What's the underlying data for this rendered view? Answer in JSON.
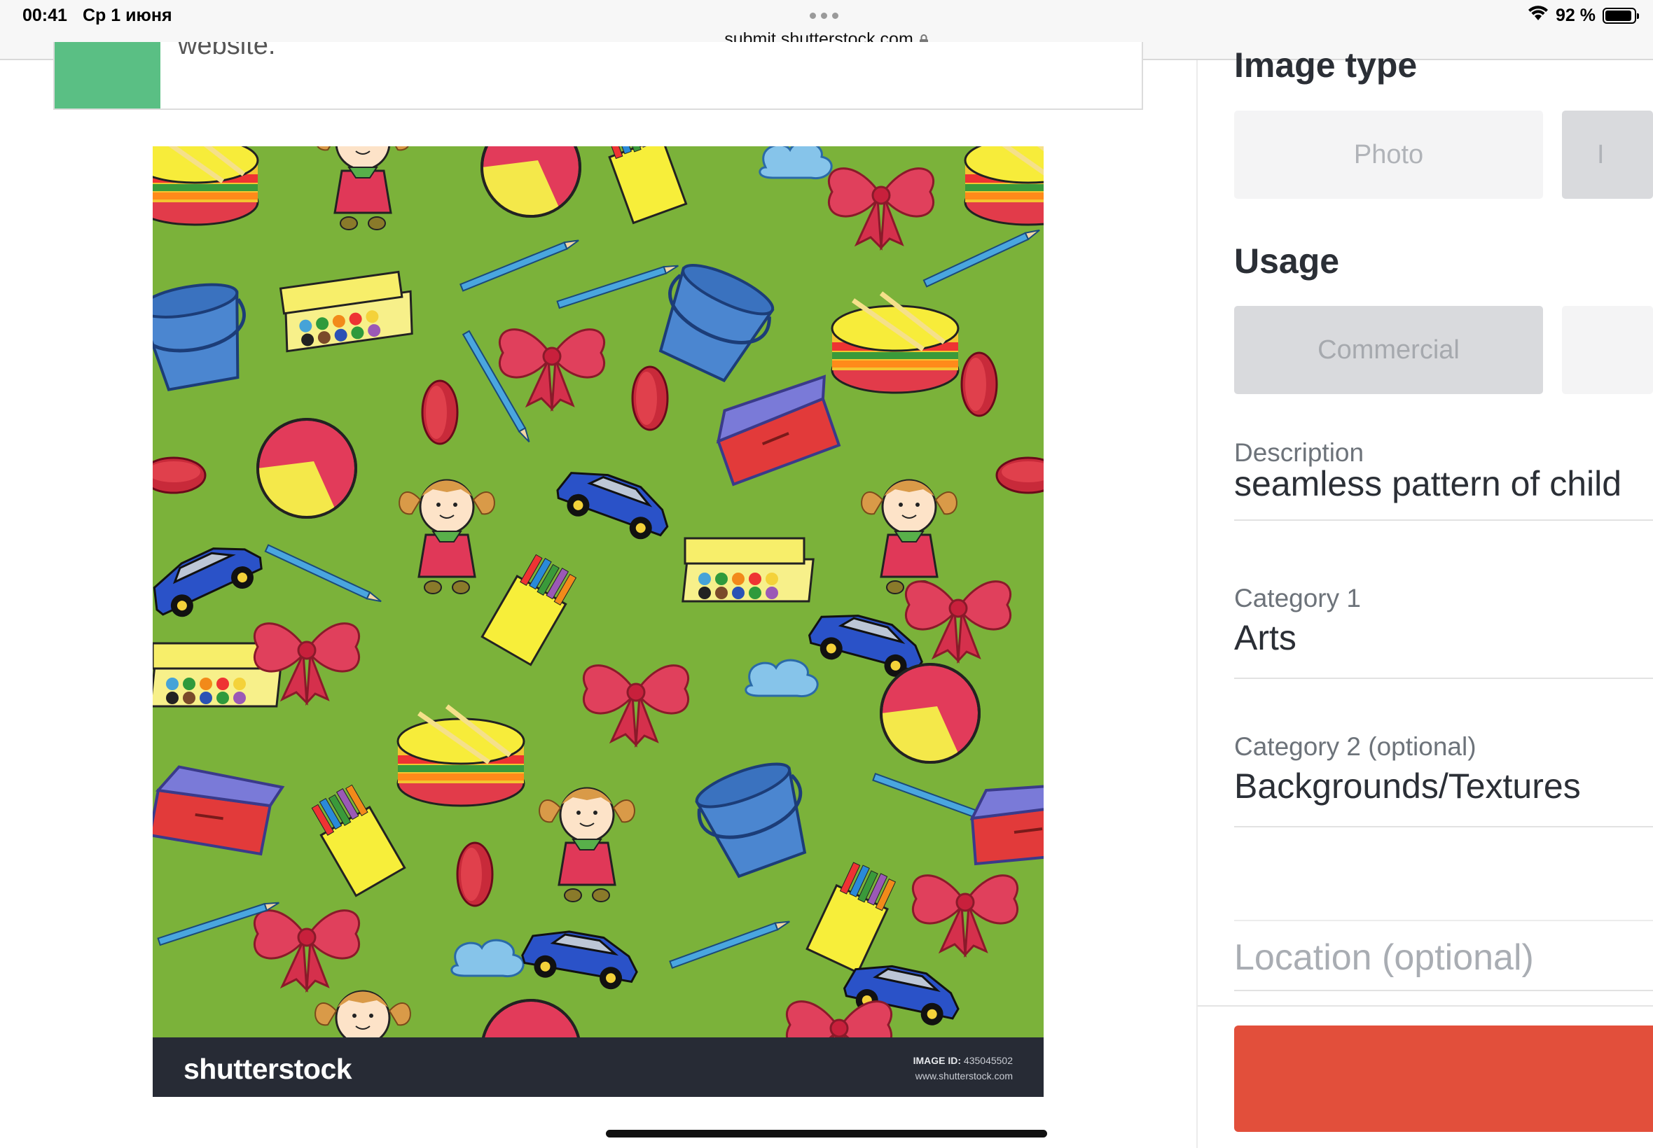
{
  "status_bar": {
    "time": "00:41",
    "date": "Ср 1 июня",
    "url": "submit.shutterstock.com",
    "battery": "92 %",
    "battery_level": 0.92
  },
  "notice": {
    "text": "website."
  },
  "preview": {
    "brand": "shutterstock",
    "image_id_label": "IMAGE ID:",
    "image_id": "435045502",
    "site": "www.shutterstock.com"
  },
  "form": {
    "image_type": {
      "title": "Image type",
      "options": [
        "Photo",
        "I"
      ]
    },
    "usage": {
      "title": "Usage",
      "options": [
        "Commercial",
        ""
      ]
    },
    "description": {
      "label": "Description",
      "value": "seamless pattern of child"
    },
    "category1": {
      "label": "Category 1",
      "value": "Arts"
    },
    "category2": {
      "label": "Category 2 (optional)",
      "value": "Backgrounds/Textures"
    },
    "location": {
      "placeholder": "Location (optional)"
    }
  },
  "colors": {
    "accent_green": "#5abf84",
    "submit_red": "#e24f3b",
    "pattern_background": "#7bb23a"
  }
}
